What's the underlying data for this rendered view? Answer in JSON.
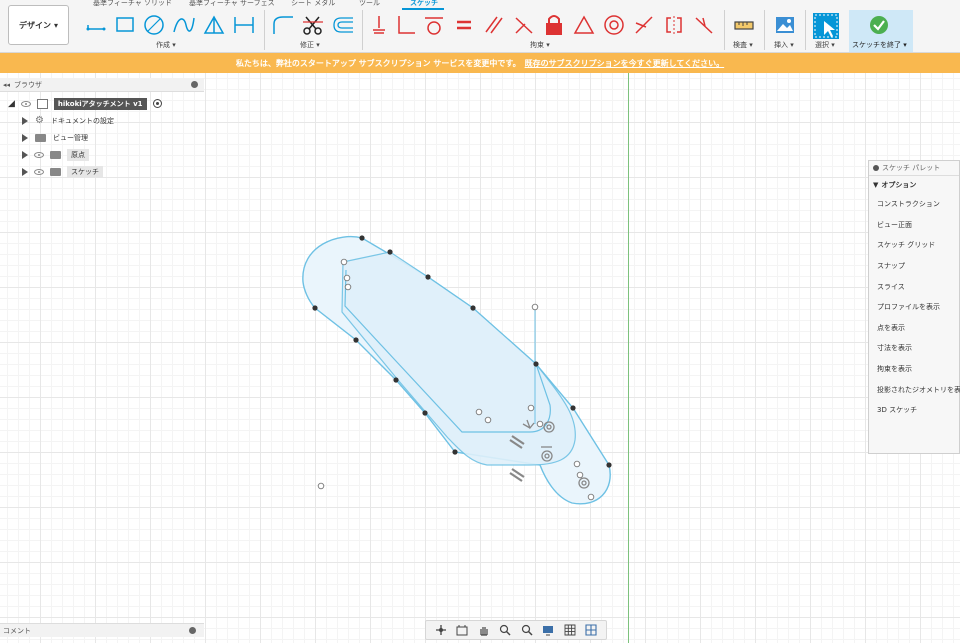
{
  "toolbar": {
    "design_label": "デザイン",
    "tabs": [
      "基準フィーチャ ソリッド",
      "基準フィーチャ サーフェス",
      "シート メタル",
      "ツール",
      "スケッチ"
    ],
    "groups": {
      "create": "作成",
      "modify": "修正",
      "constraints": "拘束",
      "inspect": "検査",
      "insert": "挿入",
      "select": "選択",
      "finish": "スケッチを終了"
    },
    "accent_color": "#0696d7"
  },
  "banner": {
    "text": "私たちは、弊社のスタートアップ サブスクリプション サービスを変更中です。",
    "link": "既存のサブスクリプションを今すぐ更新してください。",
    "color": "#f9b84f"
  },
  "browser": {
    "title": "ブラウザ",
    "root": "hikokiアタッチメント v1",
    "items": [
      {
        "label": "ドキュメントの設定",
        "icon": "gear-icon"
      },
      {
        "label": "ビュー管理",
        "icon": "folder-icon"
      },
      {
        "label": "原点",
        "icon": "folder-icon"
      },
      {
        "label": "スケッチ",
        "icon": "folder-icon"
      }
    ]
  },
  "palette": {
    "title": "スケッチ パレット",
    "section": "オプション",
    "items": [
      "コンストラクション",
      "ビュー正面",
      "スケッチ グリッド",
      "スナップ",
      "スライス",
      "プロファイルを表示",
      "点を表示",
      "寸法を表示",
      "拘束を表示",
      "投影されたジオメトリを表示",
      "3D スケッチ"
    ]
  },
  "comments": {
    "label": "コメント"
  },
  "navbar": {
    "icons": [
      "orbit-icon",
      "look-at-icon",
      "pan-icon",
      "zoom-window-icon",
      "zoom-icon",
      "display-settings-icon",
      "grid-settings-icon",
      "viewports-icon"
    ]
  }
}
